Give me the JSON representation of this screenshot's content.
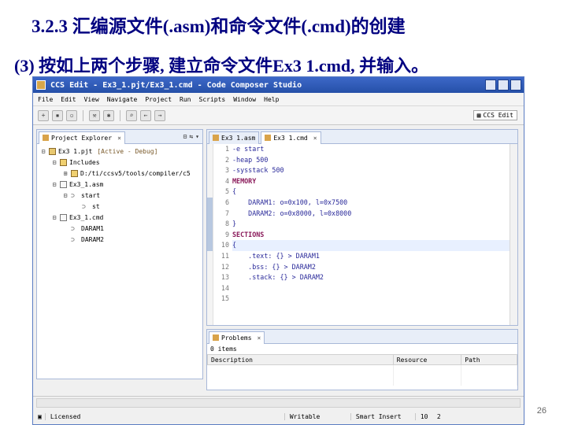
{
  "slide": {
    "title": "3.2.3 汇编源文件(.asm)和命令文件(.cmd)的创建",
    "subtitle": "(3)  按如上两个步骤, 建立命令文件Ex3  1.cmd, 并输入。",
    "page_number": "26"
  },
  "window": {
    "title": "CCS Edit - Ex3_1.pjt/Ex3_1.cmd - Code Composer Studio"
  },
  "menu": [
    "File",
    "Edit",
    "View",
    "Navigate",
    "Project",
    "Run",
    "Scripts",
    "Window",
    "Help"
  ],
  "toolbar": {
    "perspective_label": "CCS Edit"
  },
  "explorer": {
    "tab_label": "Project Explorer",
    "tree": [
      {
        "indent": 0,
        "twist": "⊟",
        "icon": "project",
        "label": "Ex3 1.pjt",
        "status": "[Active - Debug]"
      },
      {
        "indent": 1,
        "twist": "⊟",
        "icon": "folder",
        "label": "Includes",
        "status": ""
      },
      {
        "indent": 2,
        "twist": "⊞",
        "icon": "folder",
        "label": "D:/ti/ccsv5/tools/compiler/c5",
        "status": ""
      },
      {
        "indent": 1,
        "twist": "⊟",
        "icon": "file",
        "label": "Ex3_1.asm",
        "status": ""
      },
      {
        "indent": 2,
        "twist": "⊟",
        "icon": "section",
        "label": "start",
        "status": ""
      },
      {
        "indent": 3,
        "twist": "",
        "icon": "section",
        "label": "st",
        "status": ""
      },
      {
        "indent": 1,
        "twist": "⊟",
        "icon": "file",
        "label": "Ex3_1.cmd",
        "status": ""
      },
      {
        "indent": 2,
        "twist": "",
        "icon": "section",
        "label": "DARAM1",
        "status": ""
      },
      {
        "indent": 2,
        "twist": "",
        "icon": "section",
        "label": "DARAM2",
        "status": ""
      }
    ]
  },
  "editor": {
    "tabs": [
      {
        "label": "Ex3 1.asm",
        "active": false
      },
      {
        "label": "Ex3 1.cmd",
        "active": true
      }
    ],
    "lines": [
      {
        "n": "1",
        "text": "-e start",
        "kw": false
      },
      {
        "n": "2",
        "text": "-heap 500",
        "kw": false
      },
      {
        "n": "3",
        "text": "-sysstack 500",
        "kw": false
      },
      {
        "n": "4",
        "text": "MEMORY",
        "kw": true
      },
      {
        "n": "5",
        "text": "{",
        "kw": false
      },
      {
        "n": "6",
        "text": "    DARAM1: o=0x100, l=0x7500",
        "kw": false
      },
      {
        "n": "7",
        "text": "    DARAM2: o=0x8000, l=0x8000",
        "kw": false
      },
      {
        "n": "8",
        "text": "}",
        "kw": false
      },
      {
        "n": "9",
        "text": "SECTIONS",
        "kw": true
      },
      {
        "n": "10",
        "text": "{",
        "kw": false
      },
      {
        "n": "11",
        "text": "    .text: {} > DARAM1",
        "kw": false
      },
      {
        "n": "12",
        "text": "    .bss: {} > DARAM2",
        "kw": false
      },
      {
        "n": "13",
        "text": "    .stack: {} > DARAM2",
        "kw": false
      },
      {
        "n": "14",
        "text": "",
        "kw": false
      },
      {
        "n": "15",
        "text": "",
        "kw": false
      }
    ],
    "current_line": "10"
  },
  "problems": {
    "tab_label": "Problems",
    "summary": "0 items",
    "columns": [
      "Description",
      "Resource",
      "Path"
    ]
  },
  "status": {
    "licensed": "Licensed",
    "writable": "Writable",
    "insert_mode": "Smart Insert",
    "line": "10",
    "column": "2"
  },
  "colors": {
    "title_text": "#000080",
    "window_title_bar": "#2f5bb8",
    "keyword": "#8a1a5a",
    "code": "#2a2a9a"
  }
}
